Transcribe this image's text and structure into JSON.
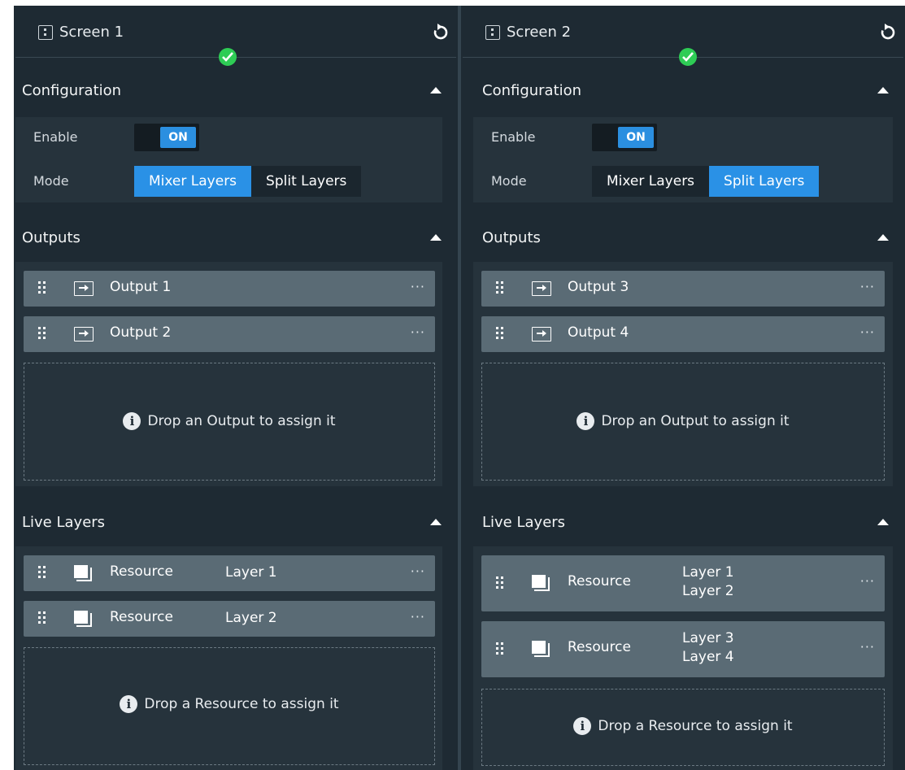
{
  "screens": [
    {
      "title": "Screen 1",
      "configuration": {
        "heading": "Configuration",
        "enable_label": "Enable",
        "toggle_label": "ON",
        "mode_label": "Mode",
        "mode_options": [
          "Mixer Layers",
          "Split Layers"
        ],
        "mode_selected": "Mixer Layers"
      },
      "outputs": {
        "heading": "Outputs",
        "items": [
          "Output 1",
          "Output 2"
        ],
        "drop_text": "Drop an Output to assign it"
      },
      "live_layers": {
        "heading": "Live Layers",
        "items": [
          {
            "label": "Resource",
            "layers": [
              "Layer 1"
            ]
          },
          {
            "label": "Resource",
            "layers": [
              "Layer 2"
            ]
          }
        ],
        "drop_text": "Drop a Resource to assign it"
      }
    },
    {
      "title": "Screen 2",
      "configuration": {
        "heading": "Configuration",
        "enable_label": "Enable",
        "toggle_label": "ON",
        "mode_label": "Mode",
        "mode_options": [
          "Mixer Layers",
          "Split Layers"
        ],
        "mode_selected": "Split Layers"
      },
      "outputs": {
        "heading": "Outputs",
        "items": [
          "Output 3",
          "Output 4"
        ],
        "drop_text": "Drop an Output to assign it"
      },
      "live_layers": {
        "heading": "Live Layers",
        "items": [
          {
            "label": "Resource",
            "layers": [
              "Layer 1",
              "Layer 2"
            ]
          },
          {
            "label": "Resource",
            "layers": [
              "Layer 3",
              "Layer 4"
            ]
          }
        ],
        "drop_text": "Drop a Resource to assign it"
      }
    }
  ],
  "more_label": "···",
  "info_glyph": "i",
  "colors": {
    "background": "#1e2a33",
    "panel": "#26333c",
    "item": "#5a6b75",
    "accent": "#2a91e6",
    "status_ok": "#2ecc55"
  }
}
